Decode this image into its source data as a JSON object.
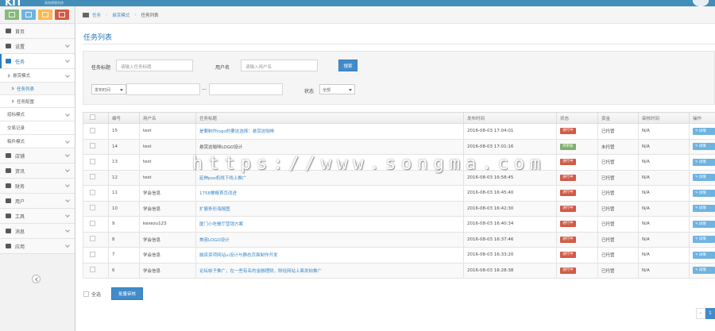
{
  "brand": {
    "logo": "KIT",
    "sub": "高效便捷系统"
  },
  "colors": {
    "accent": "#428bca",
    "header": "#438eb9",
    "badge_red": "#d15b47",
    "badge_green": "#82af6f",
    "op_btn": "#6fb3e0",
    "shortcut_colors": [
      "#87b87f",
      "#6fb3e0",
      "#ffb752",
      "#d15b47"
    ]
  },
  "shortcuts": [
    {
      "icon": "chart-icon"
    },
    {
      "icon": "pencil-icon"
    },
    {
      "icon": "users-icon"
    },
    {
      "icon": "gears-icon"
    }
  ],
  "sidebar": {
    "items": [
      {
        "label": "首页",
        "icon": "home-icon"
      },
      {
        "label": "设置",
        "icon": "gear-icon"
      },
      {
        "label": "任务",
        "icon": "list-icon",
        "active": true
      },
      {
        "label": "悬赏模式",
        "sub": true
      },
      {
        "label": "任务列表",
        "sub3": true,
        "current": true
      },
      {
        "label": "任务配置",
        "sub3": true
      },
      {
        "label": "招标模式",
        "sub": true
      },
      {
        "label": "交易记录",
        "sub": true
      },
      {
        "label": "稿件模式",
        "sub": true
      },
      {
        "label": "店铺",
        "icon": "shop-icon"
      },
      {
        "label": "资讯",
        "icon": "pencil-icon"
      },
      {
        "label": "财务",
        "icon": "chart-icon"
      },
      {
        "label": "用户",
        "icon": "users-icon"
      },
      {
        "label": "工具",
        "icon": "tag-icon"
      },
      {
        "label": "消息",
        "icon": "mail-icon"
      },
      {
        "label": "应用",
        "icon": "puzzle-icon"
      }
    ]
  },
  "breadcrumb": [
    "任务",
    "悬赏模式",
    "任务列表"
  ],
  "page_title": "任务列表",
  "search": {
    "title_label": "任务标题",
    "title_placeholder": "请输入任务标题",
    "user_label": "用户名",
    "user_placeholder": "请输入用户名",
    "search_button": "搜索",
    "time_select": "发布时间",
    "range_sep": "—",
    "status_label": "状态",
    "status_select": "全部"
  },
  "table": {
    "headers": [
      "",
      "编号",
      "用户名",
      "任务标题",
      "发布时间",
      "状态",
      "资金",
      "审核时间",
      "操作"
    ],
    "rows": [
      {
        "id": "15",
        "user": "test",
        "title": "是要制作logo的要这选择：悬赏这咖啡",
        "link": true,
        "time": "2016-08-03 17:04:01",
        "status": "进行中",
        "status_type": "red",
        "fund": "已托管",
        "audit": "N/A",
        "op": "详情"
      },
      {
        "id": "14",
        "user": "test",
        "title": "悬赏这咖啡LOGO设计",
        "link": false,
        "time": "2016-08-03 17:01:16",
        "status": "待审核",
        "status_type": "green",
        "fund": "未托管",
        "audit": "N/A",
        "op": "详情"
      },
      {
        "id": "13",
        "user": "test",
        "title": "",
        "link": true,
        "time": "",
        "status": "进行中",
        "status_type": "red",
        "fund": "已托管",
        "audit": "N/A",
        "op": "详情"
      },
      {
        "id": "12",
        "user": "test",
        "title": "延伸pos机线下线上推广",
        "link": true,
        "time": "2016-08-03 16:58:45",
        "status": "进行中",
        "status_type": "red",
        "fund": "已托管",
        "audit": "N/A",
        "op": "详情"
      },
      {
        "id": "11",
        "user": "学会信息",
        "title": "1758梗概首页改进",
        "link": true,
        "time": "2016-08-03 16:45:40",
        "status": "进行中",
        "status_type": "red",
        "fund": "已托管",
        "audit": "N/A",
        "op": "详情"
      },
      {
        "id": "10",
        "user": "学会信息",
        "title": "扩展条形海报图",
        "link": true,
        "time": "2016-08-03 16:42:30",
        "status": "进行中",
        "status_type": "red",
        "fund": "已托管",
        "audit": "N/A",
        "op": "详情"
      },
      {
        "id": "9",
        "user": "kexezu123",
        "title": "厦门小吃餐厅营销方案",
        "link": true,
        "time": "2016-08-03 16:40:34",
        "status": "进行中",
        "status_type": "red",
        "fund": "已托管",
        "audit": "N/A",
        "op": "详情"
      },
      {
        "id": "8",
        "user": "学会信息",
        "title": "美容LOGO设计",
        "link": true,
        "time": "2016-08-03 16:37:46",
        "status": "进行中",
        "status_type": "red",
        "fund": "已托管",
        "audit": "N/A",
        "op": "详情"
      },
      {
        "id": "7",
        "user": "学会信息",
        "title": "融资资项网站ui设计与静态页面制作开发",
        "link": true,
        "time": "2016-08-03 16:33:20",
        "status": "进行中",
        "status_type": "red",
        "fund": "已托管",
        "audit": "N/A",
        "op": "详情"
      },
      {
        "id": "6",
        "user": "学会信息",
        "title": "论坛帖子推广，在一些有名的金融理财，財经网站上面发帖推广",
        "link": true,
        "time": "2016-08-03 16:28:38",
        "status": "进行中",
        "status_type": "red",
        "fund": "已托管",
        "audit": "N/A",
        "op": "详情"
      }
    ]
  },
  "footer": {
    "select_all": "全选",
    "batch_button": "批量审核"
  },
  "pager": [
    "‹",
    "1"
  ],
  "watermark": "https://www.songma.com"
}
